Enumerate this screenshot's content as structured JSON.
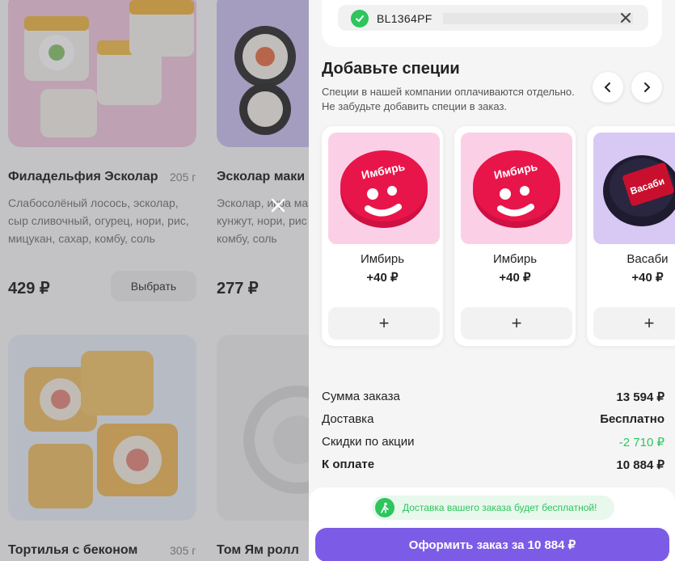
{
  "products": [
    {
      "title": "Филадельфия Эсколар",
      "weight": "205 г",
      "desc": [
        "Слабосолёный лосось, эсколар,",
        "сыр сливочный, огурец, нори, рис,",
        "мицукан, сахар, комбу, соль"
      ],
      "price": "429 ₽",
      "button": "Выбрать"
    },
    {
      "title": "Эсколар маки",
      "weight": "",
      "desc": [
        "Эсколар, икра маки",
        "кунжут, нори, рис",
        "комбу, соль"
      ],
      "price": "277 ₽",
      "button": ""
    },
    {
      "title": "Тортилья с беконом",
      "weight": "305 г",
      "desc": [],
      "price": "",
      "button": ""
    },
    {
      "title": "Том Ям ролл",
      "weight": "",
      "desc": [],
      "price": "",
      "button": ""
    }
  ],
  "promo": {
    "code": "BL1364PF",
    "status": "applied"
  },
  "spices": {
    "title": "Добавьте специи",
    "note_line1": "Специи в нашей компании оплачиваются отдельно.",
    "note_line2": "Не забудьте добавить специи в заказ.",
    "items": [
      {
        "name": "Имбирь",
        "price": "+40 ₽",
        "label": "Имбирь",
        "color": "#e8154b",
        "bg": "#fbd0e6"
      },
      {
        "name": "Имбирь",
        "price": "+40 ₽",
        "label": "Имбирь",
        "color": "#e8154b",
        "bg": "#fbd0e6"
      },
      {
        "name": "Васаби",
        "price": "+40 ₽",
        "label": "Васаби",
        "color": "#c8102e",
        "bg": "#d7c8f4"
      }
    ],
    "add_label": "+"
  },
  "summary": {
    "rows": [
      {
        "label": "Сумма заказа",
        "value": "13 594 ₽"
      },
      {
        "label": "Доставка",
        "value": "Бесплатно"
      },
      {
        "label": "Скидки по акции",
        "value": "-2 710 ₽"
      },
      {
        "label": "К оплате",
        "value": "10 884 ₽"
      }
    ]
  },
  "free_delivery": "Доставка вашего заказа будет бесплатной!",
  "order_button": "Оформить заказ за 10 884 ₽",
  "colors": {
    "accent": "#7c5ce6",
    "success": "#2ec55d"
  }
}
